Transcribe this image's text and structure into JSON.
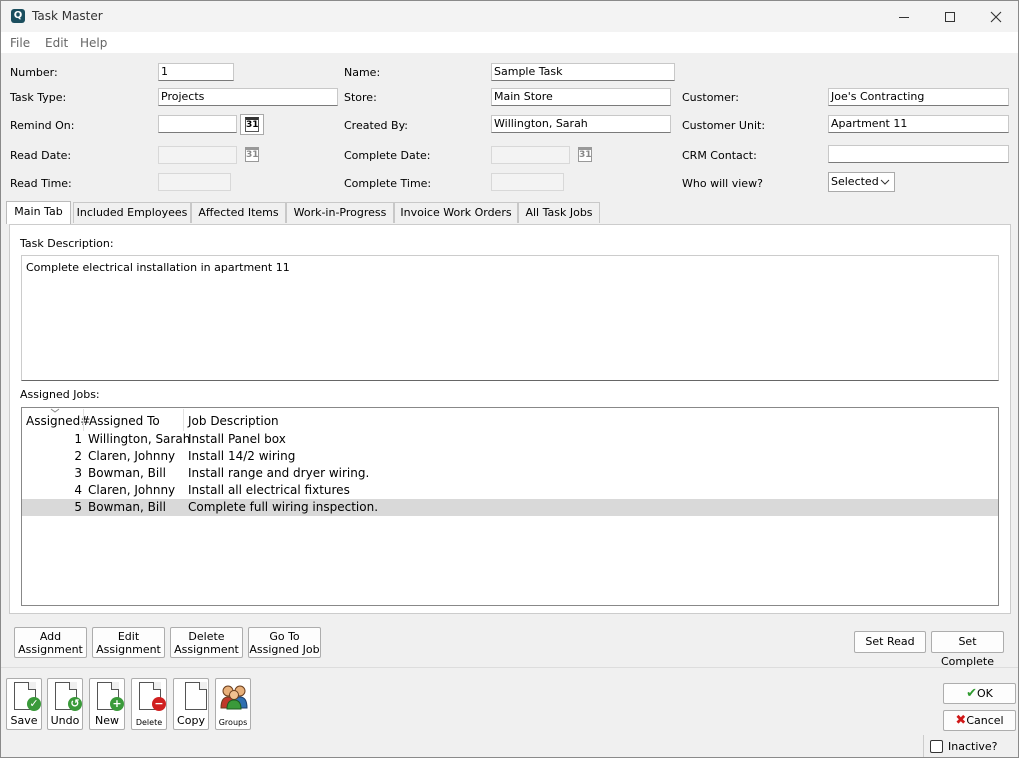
{
  "window": {
    "title": "Task Master",
    "app_icon": "Q"
  },
  "menu": [
    "File",
    "Edit",
    "Help"
  ],
  "fields": {
    "number": {
      "label": "Number:",
      "value": "1"
    },
    "name": {
      "label": "Name:",
      "value": "Sample Task"
    },
    "task_type": {
      "label": "Task Type:",
      "value": "Projects"
    },
    "store": {
      "label": "Store:",
      "value": "Main Store"
    },
    "customer": {
      "label": "Customer:",
      "value": "Joe's Contracting"
    },
    "remind_on": {
      "label": "Remind On:",
      "value": ""
    },
    "created_by": {
      "label": "Created By:",
      "value": "Willington, Sarah"
    },
    "customer_unit": {
      "label": "Customer Unit:",
      "value": "Apartment 11"
    },
    "read_date": {
      "label": "Read Date:",
      "value": ""
    },
    "complete_date": {
      "label": "Complete Date:",
      "value": ""
    },
    "crm_contact": {
      "label": "CRM Contact:",
      "value": ""
    },
    "read_time": {
      "label": "Read Time:",
      "value": ""
    },
    "complete_time": {
      "label": "Complete Time:",
      "value": ""
    },
    "who_will_view": {
      "label": "Who will view?",
      "value": "Selected"
    },
    "calendar_glyph": "31"
  },
  "tabs": [
    "Main Tab",
    "Included Employees",
    "Affected Items",
    "Work-in-Progress",
    "Invoice Work Orders",
    "All Task Jobs"
  ],
  "main_tab": {
    "description_label": "Task Description:",
    "description": "Complete electrical installation in apartment 11",
    "jobs_label": "Assigned Jobs:",
    "columns": [
      "Assigned#",
      "Assigned To",
      "Job Description"
    ],
    "rows": [
      {
        "num": "1",
        "to": "Willington, Sarah",
        "desc": "Install Panel box"
      },
      {
        "num": "2",
        "to": "Claren, Johnny",
        "desc": "Install 14/2 wiring"
      },
      {
        "num": "3",
        "to": "Bowman, Bill",
        "desc": "Install range and dryer wiring."
      },
      {
        "num": "4",
        "to": "Claren, Johnny",
        "desc": "Install all electrical fixtures"
      },
      {
        "num": "5",
        "to": "Bowman, Bill",
        "desc": "Complete full wiring inspection."
      }
    ]
  },
  "assignment_buttons": {
    "add_1": "Add",
    "add_2": "Assignment",
    "edit_1": "Edit",
    "edit_2": "Assignment",
    "delete_1": "Delete",
    "delete_2": "Assignment",
    "goto_1": "Go To",
    "goto_2": "Assigned Job",
    "set_read": "Set Read",
    "set_complete": "Set Complete"
  },
  "toolbar": {
    "save": "Save",
    "undo": "Undo",
    "new": "New",
    "delete": "Delete",
    "copy": "Copy",
    "groups": "Groups"
  },
  "dialog": {
    "ok": "OK",
    "cancel": "Cancel",
    "inactive": "Inactive?"
  },
  "colors": {
    "ok_check": "#2e9a2e",
    "cancel_x": "#d01818",
    "selected_row": "#d9d9d9"
  }
}
